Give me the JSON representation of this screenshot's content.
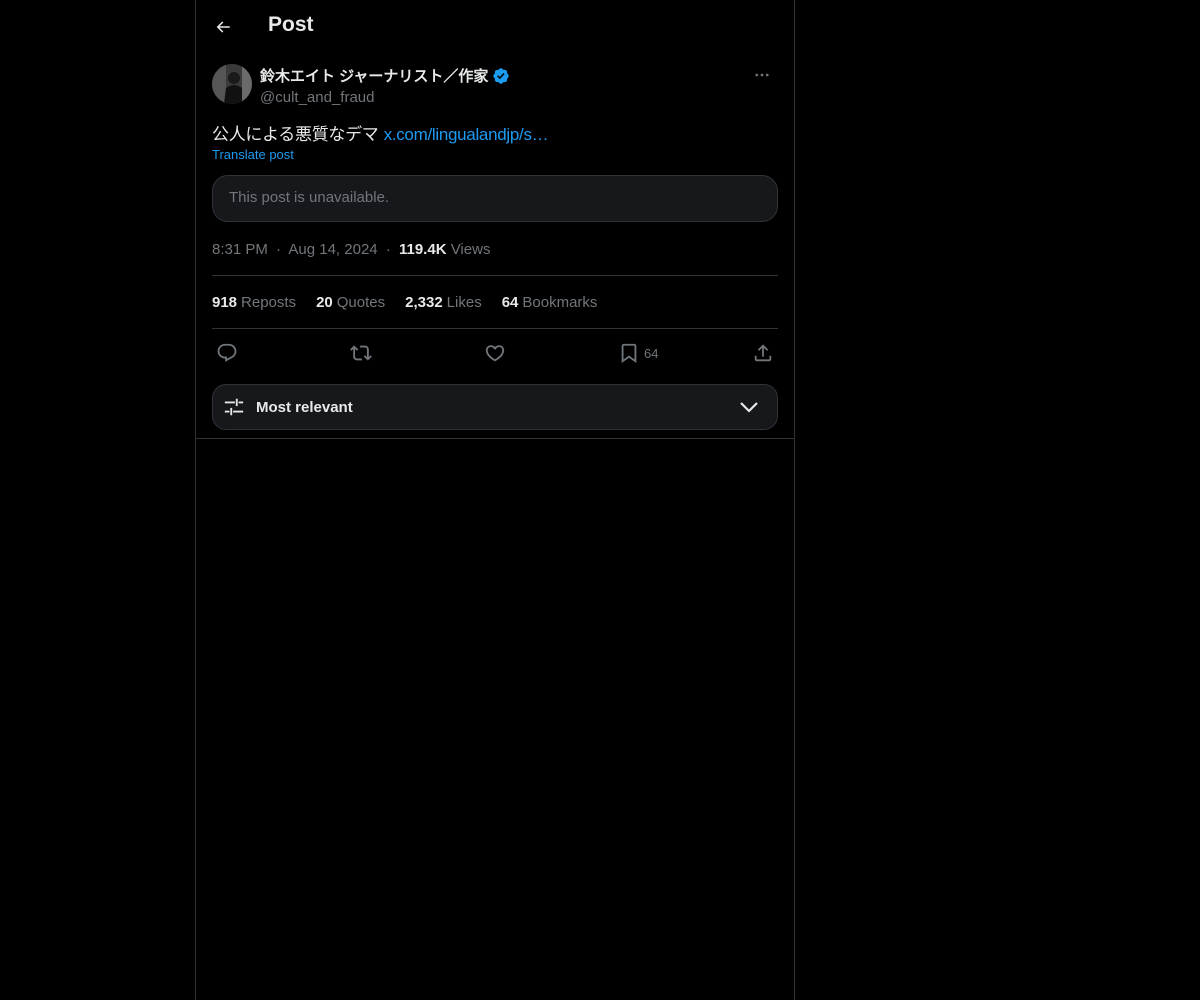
{
  "header": {
    "title": "Post",
    "back_icon": "arrow-left-icon"
  },
  "post": {
    "author_name": "鈴木エイト ジャーナリスト／作家",
    "handle": "@cult_and_fraud",
    "verified_icon": "verified-badge-icon",
    "more_icon": "more-icon",
    "text": "公人による悪質なデマ",
    "link": "x.com/lingualandjp/s…",
    "translate_label": "Translate post",
    "quoted_unavailable": "This post is unavailable.",
    "time": "8:31 PM",
    "date": "Aug 14, 2024",
    "views_count": "119.4K",
    "views_label": "Views",
    "separator": "·"
  },
  "stats": {
    "reposts_count": "918",
    "reposts_label": "Reposts",
    "quotes_count": "20",
    "quotes_label": "Quotes",
    "likes_count": "2,332",
    "likes_label": "Likes",
    "bookmarks_count": "64",
    "bookmarks_label": "Bookmarks"
  },
  "actions": {
    "reply_icon": "reply-icon",
    "repost_icon": "repost-icon",
    "like_icon": "heart-icon",
    "bookmark_icon": "bookmark-icon",
    "bookmark_count": "64",
    "share_icon": "share-icon"
  },
  "sort": {
    "label": "Most relevant",
    "icon": "sliders-icon",
    "chevron": "chevron-down-icon"
  },
  "colors": {
    "background": "#000000",
    "accent": "#1d9bf0",
    "muted": "#71767b",
    "border": "#2f3336"
  }
}
